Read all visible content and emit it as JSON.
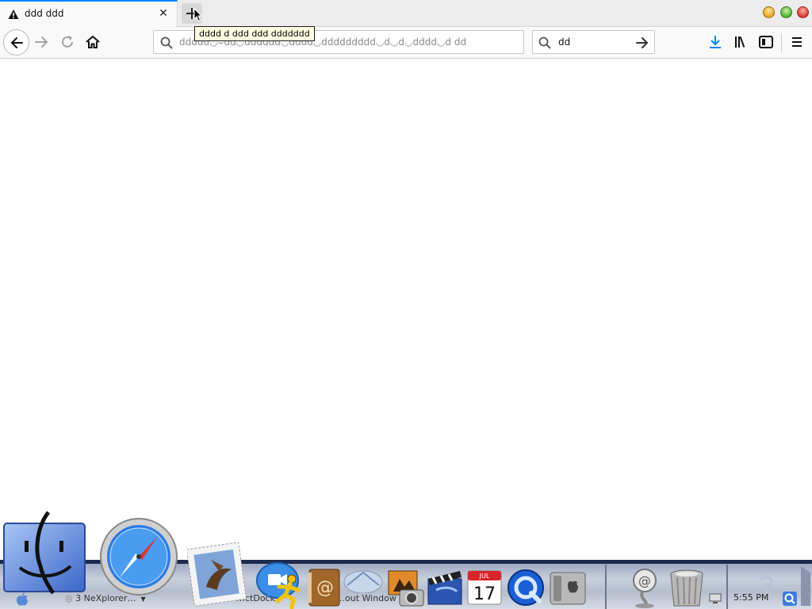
{
  "browser": {
    "tab": {
      "title": "ddd ddd",
      "close": "✕"
    },
    "new_tab_tooltip": "dddd d ddd ddd ddddddd",
    "url_text": "ddddd◡⌣dd◡dddddd◡dddd◡ddddddddd◡d◡d◡dddd◡d   dd",
    "search_text": "dd"
  },
  "taskbar": {
    "items": [
      {
        "label": "3 NeXplorer…"
      },
      {
        "label": "…ctDock"
      },
      {
        "label": "…out Window"
      }
    ],
    "clock": "5:55 PM"
  },
  "dock": {
    "apps": [
      "finder-icon",
      "safari-icon",
      "mail-icon",
      "ichat-icon",
      "aim-icon",
      "address-book-icon",
      "iphoto-icon",
      "imovie-icon",
      "ical-icon",
      "quicktime-icon",
      "system-preferences-icon",
      "internet-icon",
      "trash-icon"
    ],
    "ical_day": "17",
    "ical_month": "JUL"
  },
  "colors": {
    "accent": "#0a84ff",
    "tooltip_bg": "#ffffe1",
    "dock_base": "#1d2a4f"
  }
}
